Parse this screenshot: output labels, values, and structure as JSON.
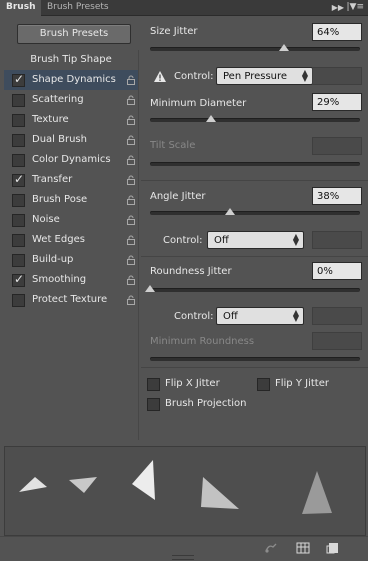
{
  "tabs": [
    {
      "label": "Brush",
      "active": true
    },
    {
      "label": "Brush Presets",
      "active": false
    }
  ],
  "header_icons": {
    "collapse": "double-chevron-right-icon",
    "menu": "panel-menu-icon"
  },
  "brush_presets_button": "Brush Presets",
  "left_list": {
    "tip_shape_label": "Brush Tip Shape",
    "options": [
      {
        "label": "Shape Dynamics",
        "checked": true,
        "selected": true
      },
      {
        "label": "Scattering",
        "checked": false,
        "selected": false
      },
      {
        "label": "Texture",
        "checked": false,
        "selected": false
      },
      {
        "label": "Dual Brush",
        "checked": false,
        "selected": false
      },
      {
        "label": "Color Dynamics",
        "checked": false,
        "selected": false
      },
      {
        "label": "Transfer",
        "checked": true,
        "selected": false
      },
      {
        "label": "Brush Pose",
        "checked": false,
        "selected": false
      },
      {
        "label": "Noise",
        "checked": false,
        "selected": false
      },
      {
        "label": "Wet Edges",
        "checked": false,
        "selected": false
      },
      {
        "label": "Build-up",
        "checked": false,
        "selected": false
      },
      {
        "label": "Smoothing",
        "checked": true,
        "selected": false
      },
      {
        "label": "Protect Texture",
        "checked": false,
        "selected": false
      }
    ]
  },
  "settings": {
    "size_jitter": {
      "label": "Size Jitter",
      "value": "64%",
      "level": 0.64
    },
    "size_control": {
      "label": "Control:",
      "selected": "Pen Pressure"
    },
    "minimum_diameter": {
      "label": "Minimum Diameter",
      "value": "29%",
      "level": 0.29
    },
    "tilt_scale": {
      "label": "Tilt Scale"
    },
    "angle_jitter": {
      "label": "Angle Jitter",
      "value": "38%",
      "level": 0.38
    },
    "angle_control": {
      "label": "Control:",
      "selected": "Off"
    },
    "roundness_jitter": {
      "label": "Roundness Jitter",
      "value": "0%",
      "level": 0.0
    },
    "roundness_control": {
      "label": "Control:",
      "selected": "Off"
    },
    "minimum_roundness": {
      "label": "Minimum Roundness"
    },
    "flip_x": {
      "label": "Flip X Jitter",
      "checked": false
    },
    "flip_y": {
      "label": "Flip Y Jitter",
      "checked": false
    },
    "brush_projection": {
      "label": "Brush Projection",
      "checked": false
    }
  },
  "colors": {
    "panel_bg": "#535353",
    "selection": "#3e4c5d",
    "value_box": "#e6e6e6",
    "warning": "#e8e8e8"
  },
  "statusbar_icons": [
    "toggle-live-tip-icon",
    "grid-icon",
    "create-new-brush-icon"
  ]
}
